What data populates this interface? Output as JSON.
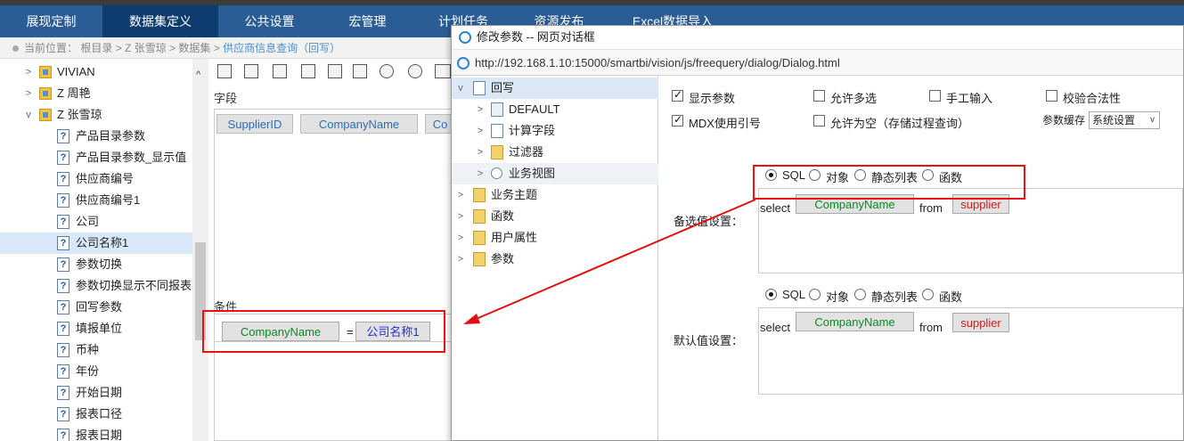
{
  "nav": {
    "tabs": [
      "展现定制",
      "数据集定义",
      "公共设置",
      "宏管理",
      "计划任务",
      "资源发布",
      "Excel数据导入"
    ]
  },
  "breadcrumb": {
    "prefix": "当前位置：",
    "path": "根目录 > Z 张雪琼 > 数据集 >",
    "current": "供应商信息查询（回写）"
  },
  "left_tree": {
    "folders": [
      "VIVIAN",
      "Z 周艳",
      "Z 张雪琼"
    ],
    "items": [
      "产品目录参数",
      "产品目录参数_显示值",
      "供应商编号",
      "供应商编号1",
      "公司",
      "公司名称1",
      "参数切换",
      "参数切换显示不同报表",
      "回写参数",
      "填报单位",
      "币种",
      "年份",
      "开始日期",
      "报表口径",
      "报表日期"
    ],
    "selected": "公司名称1"
  },
  "middle": {
    "field_label": "字段",
    "fields": [
      "SupplierID",
      "CompanyName",
      "Co"
    ],
    "cond_label": "条件",
    "cond_field": "CompanyName",
    "cond_op": "=",
    "cond_param": "公司名称1"
  },
  "dialog": {
    "title": "修改参数 -- 网页对话框",
    "url": "http://192.168.1.10:15000/smartbi/vision/js/freequery/dialog/Dialog.html",
    "tree": {
      "root": "回写",
      "children": [
        "DEFAULT",
        "计算字段",
        "过滤器",
        "业务视图"
      ],
      "others": [
        "业务主题",
        "函数",
        "用户属性",
        "参数"
      ]
    },
    "options": {
      "show_param": "显示参数",
      "allow_multi": "允许多选",
      "manual_input": "手工输入",
      "validate": "校验合法性",
      "mdx_quote": "MDX使用引号",
      "allow_empty": "允许为空（存储过程查询）",
      "cache_label": "参数缓存",
      "cache_value": "系统设置"
    },
    "source_types": [
      "SQL",
      "对象",
      "静态列表",
      "函数"
    ],
    "candidate": {
      "label": "备选值设置：",
      "select_kw": "select",
      "field": "CompanyName",
      "from_kw": "from",
      "table": "supplier"
    },
    "default": {
      "label": "默认值设置：",
      "select_kw": "select",
      "field": "CompanyName",
      "from_kw": "from",
      "table": "supplier"
    }
  },
  "colors": {
    "nav_bg": "#2a5d95",
    "nav_active": "#0f3c6e",
    "highlight": "#e11111",
    "field_green": "#0a8a1e",
    "table_red": "#d81818",
    "param_blue": "#1d2fd6"
  }
}
